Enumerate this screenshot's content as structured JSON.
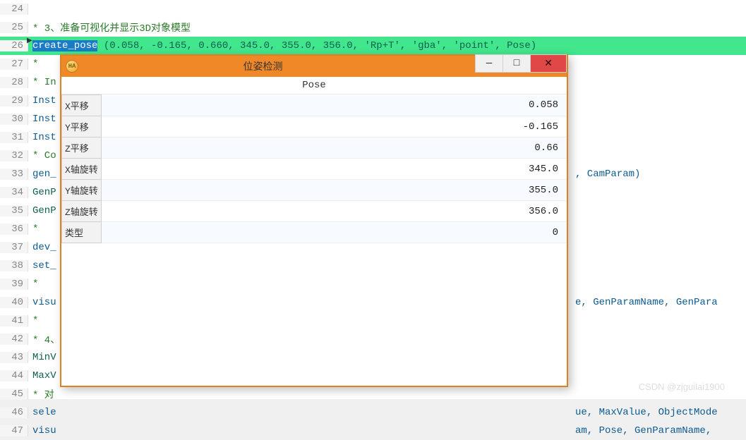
{
  "lines": [
    {
      "n": 24,
      "cls": "",
      "html": ""
    },
    {
      "n": 25,
      "cls": "comment",
      "html": "* 3、准备可视化并显示3D对象模型"
    },
    {
      "n": 26,
      "cls": "",
      "html": ""
    },
    {
      "n": 27,
      "cls": "comment",
      "html": "*"
    },
    {
      "n": 28,
      "cls": "comment",
      "html": "* In"
    },
    {
      "n": 29,
      "cls": "blue-ident",
      "html": "Inst"
    },
    {
      "n": 30,
      "cls": "blue-ident",
      "html": "Inst"
    },
    {
      "n": 31,
      "cls": "blue-ident",
      "html": "Inst"
    },
    {
      "n": 32,
      "cls": "comment",
      "html": "* Co"
    },
    {
      "n": 33,
      "cls": "blue-ident",
      "html": "gen_"
    },
    {
      "n": 34,
      "cls": "ident",
      "html": "GenP"
    },
    {
      "n": 35,
      "cls": "ident",
      "html": "GenP"
    },
    {
      "n": 36,
      "cls": "comment",
      "html": "*"
    },
    {
      "n": 37,
      "cls": "blue-ident",
      "html": "dev_"
    },
    {
      "n": 38,
      "cls": "blue-ident",
      "html": "set_"
    },
    {
      "n": 39,
      "cls": "comment",
      "html": "*"
    },
    {
      "n": 40,
      "cls": "blue-ident",
      "html": "visu"
    },
    {
      "n": 41,
      "cls": "comment",
      "html": "*"
    },
    {
      "n": 42,
      "cls": "comment",
      "html": "* 4、"
    },
    {
      "n": 43,
      "cls": "ident",
      "html": "MinV"
    },
    {
      "n": 44,
      "cls": "ident",
      "html": "MaxV"
    },
    {
      "n": 45,
      "cls": "comment",
      "html": "* 对"
    },
    {
      "n": 46,
      "cls": "blue-ident",
      "html": "sele"
    },
    {
      "n": 47,
      "cls": "blue-ident",
      "html": "visu"
    }
  ],
  "hl": {
    "func": "create_pose",
    "rest": " (0.058, -0.165, 0.660, 345.0, 355.0, 356.0, 'Rp+T', 'gba', 'point', Pose)"
  },
  "tails": {
    "t33": ", CamParam)",
    "t40": "e, GenParamName, GenPara",
    "t46": "ue, MaxValue, ObjectMode",
    "t47": "am, Pose, GenParamName,"
  },
  "dialog": {
    "title": "位姿检测",
    "app_icon_text": "HA",
    "header": "Pose",
    "rows": [
      {
        "label": "X平移",
        "value": "0.058"
      },
      {
        "label": "Y平移",
        "value": "-0.165"
      },
      {
        "label": "Z平移",
        "value": "0.66"
      },
      {
        "label": "X轴旋转",
        "value": "345.0"
      },
      {
        "label": "Y轴旋转",
        "value": "355.0"
      },
      {
        "label": "Z轴旋转",
        "value": "356.0"
      },
      {
        "label": "类型",
        "value": "0"
      }
    ]
  },
  "watermark": "CSDN @zjguilai1900",
  "icons": {
    "min": "—",
    "max": "□",
    "close": "✕"
  }
}
